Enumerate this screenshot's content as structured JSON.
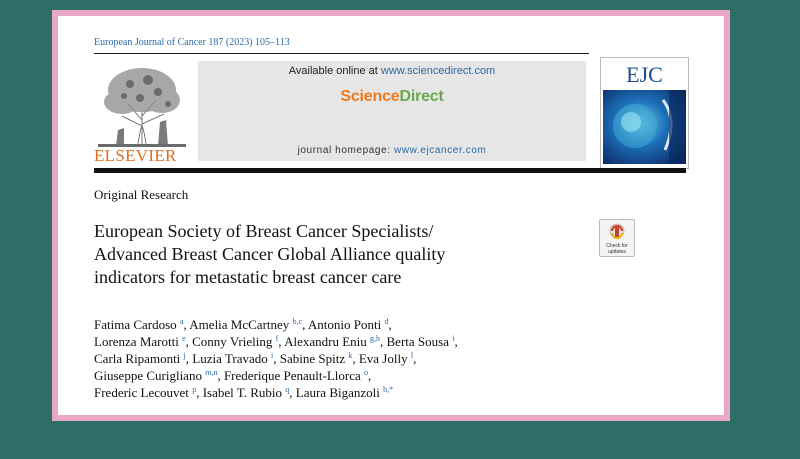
{
  "journal_citation": "European Journal of Cancer 187 (2023) 105–113",
  "publisher": {
    "name": "ELSEVIER",
    "logo_icon": "elsevier-tree-logo"
  },
  "sciencedirect": {
    "available_prefix": "Available online at ",
    "available_link": "www.sciencedirect.com",
    "brand_part1": "Science",
    "brand_part2": "Direct",
    "homepage_prefix": "journal homepage: ",
    "homepage_link": "www.ejcancer.com"
  },
  "cover": {
    "title": "EJC"
  },
  "article_type": "Original Research",
  "title_lines": [
    "European Society of Breast Cancer Specialists/",
    "Advanced Breast Cancer Global Alliance quality",
    "indicators for metastatic breast cancer care"
  ],
  "check_updates": {
    "line1": "Check for",
    "line2": "updates"
  },
  "author_lines": [
    [
      {
        "name": "Fatima Cardoso",
        "aff": "a",
        "sep": ", "
      },
      {
        "name": "Amelia McCartney",
        "aff": "b,c",
        "sep": ", "
      },
      {
        "name": "Antonio Ponti",
        "aff": "d",
        "sep": ","
      }
    ],
    [
      {
        "name": "Lorenza Marotti",
        "aff": "e",
        "sep": ", "
      },
      {
        "name": "Conny Vrieling",
        "aff": "f",
        "sep": ", "
      },
      {
        "name": "Alexandru Eniu",
        "aff": "g,h",
        "sep": ", "
      },
      {
        "name": "Berta Sousa",
        "aff": "i",
        "sep": ","
      }
    ],
    [
      {
        "name": "Carla Ripamonti",
        "aff": "j",
        "sep": ", "
      },
      {
        "name": "Luzia Travado",
        "aff": "i",
        "sep": ", "
      },
      {
        "name": "Sabine Spitz",
        "aff": "k",
        "sep": ", "
      },
      {
        "name": "Eva Jolly",
        "aff": "l",
        "sep": ","
      }
    ],
    [
      {
        "name": "Giuseppe Curigliano",
        "aff": "m,n",
        "sep": ", "
      },
      {
        "name": "Frederique Penault-Llorca",
        "aff": "o",
        "sep": ","
      }
    ],
    [
      {
        "name": "Frederic Lecouvet",
        "aff": "p",
        "sep": ", "
      },
      {
        "name": "Isabel T. Rubio",
        "aff": "q",
        "sep": ", "
      },
      {
        "name": "Laura Biganzoli",
        "aff": "b,*",
        "sep": ""
      }
    ]
  ]
}
